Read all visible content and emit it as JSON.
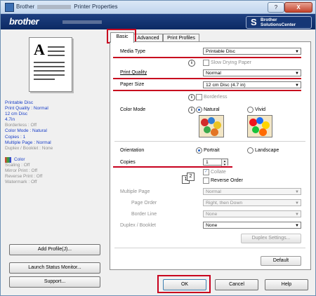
{
  "window": {
    "title_prefix": "Brother",
    "title_suffix": "Printer Properties",
    "help_label": "?",
    "close_label": "X"
  },
  "banner": {
    "brand": "brother",
    "solutions_line1": "Brother",
    "solutions_line2": "SolutionsCenter"
  },
  "tabs": [
    {
      "label": "Basic",
      "active": true
    },
    {
      "label": "Advanced",
      "active": false
    },
    {
      "label": "Print Profiles",
      "active": false
    }
  ],
  "summary": {
    "settings": [
      "Printable Disc",
      "Print Quality : Normal",
      "12 cm Disc",
      "4.7in",
      "Borderless : Off",
      "Color Mode : Natural",
      "Copies : 1",
      "Multiple Page : Normal",
      "Duplex / Booklet : None"
    ],
    "color_title": "Color",
    "color_settings": [
      "Scaling : Off",
      "Mirror Print : Off",
      "Reverse Print : Off",
      "Watermark : Off"
    ]
  },
  "left_buttons": {
    "add_profile": "Add Profile(J)...",
    "launch_status": "Launch Status Monitor...",
    "support": "Support..."
  },
  "form": {
    "media_type_label": "Media Type",
    "media_type_value": "Printable Disc",
    "slow_drying_label": "Slow Drying Paper",
    "print_quality_label": "Print Quality",
    "print_quality_value": "Normal",
    "paper_size_label": "Paper Size",
    "paper_size_value": "12 cm Disc (4.7 in)",
    "borderless_label": "Borderless",
    "color_mode_label": "Color Mode",
    "natural_label": "Natural",
    "vivid_label": "Vivid",
    "orientation_label": "Orientation",
    "portrait_label": "Portrait",
    "landscape_label": "Landscape",
    "copies_label": "Copies",
    "copies_value": "1",
    "collate_label": "Collate",
    "reverse_order_label": "Reverse Order",
    "multiple_page_label": "Multiple Page",
    "multiple_page_value": "Normal",
    "page_order_label": "Page Order",
    "page_order_value": "Right, then Down",
    "border_line_label": "Border Line",
    "border_line_value": "None",
    "duplex_label": "Duplex / Booklet",
    "duplex_value": "None",
    "duplex_settings_label": "Duplex Settings...",
    "default_label": "Default",
    "copies_icon_1": "1",
    "copies_icon_2": "2"
  },
  "footer": {
    "ok": "OK",
    "cancel": "Cancel",
    "help": "Help"
  },
  "colors": {
    "highlight": "#c8001e",
    "summary_text": "#1a3fc7",
    "banner": "#0c2a64"
  }
}
